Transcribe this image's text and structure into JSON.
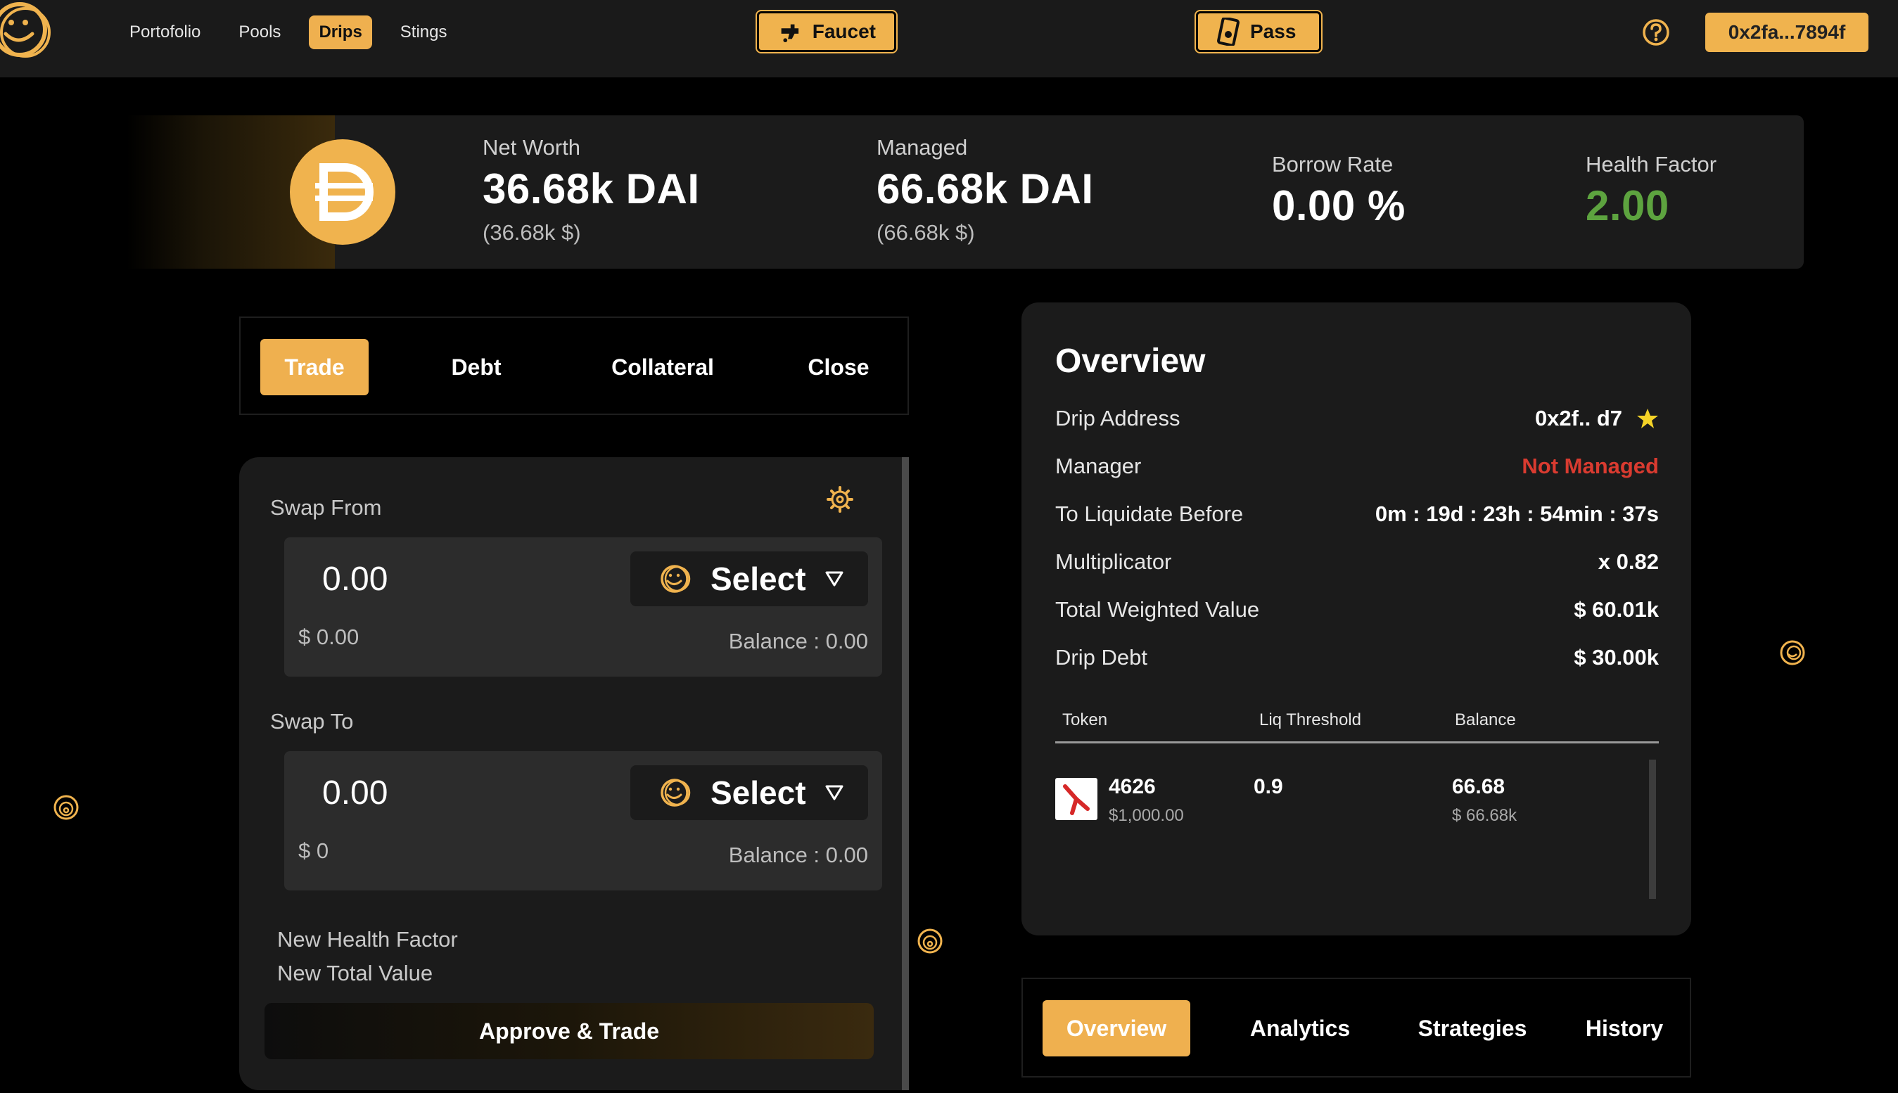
{
  "nav": {
    "items": [
      {
        "label": "Portofolio"
      },
      {
        "label": "Pools"
      },
      {
        "label": "Drips",
        "active": true
      },
      {
        "label": "Stings"
      }
    ]
  },
  "header": {
    "faucet_label": "Faucet",
    "pass_label": "Pass",
    "wallet_address": "0x2fa...7894f",
    "accent_color": "#f0b34e"
  },
  "stats": {
    "net_worth_label": "Net Worth",
    "net_worth_value": "36.68k DAI",
    "net_worth_usd": "(36.68k $)",
    "managed_label": "Managed",
    "managed_value": "66.68k DAI",
    "managed_usd": "(66.68k $)",
    "borrow_label": "Borrow Rate",
    "borrow_value": "0.00 %",
    "health_label": "Health Factor",
    "health_value": "2.00",
    "health_color": "#5da33f"
  },
  "left_tabs": [
    {
      "label": "Trade",
      "active": true
    },
    {
      "label": "Debt"
    },
    {
      "label": "Collateral"
    },
    {
      "label": "Close"
    }
  ],
  "swap": {
    "from_label": "Swap From",
    "from_amount": "0.00",
    "from_usd": "$ 0.00",
    "from_balance": "Balance : 0.00",
    "from_select": "Select",
    "to_label": "Swap To",
    "to_amount": "0.00",
    "to_usd": "$ 0",
    "to_balance": "Balance : 0.00",
    "to_select": "Select",
    "new_health_label": "New Health Factor",
    "new_total_label": "New Total Value",
    "approve_label": "Approve & Trade"
  },
  "overview": {
    "title": "Overview",
    "rows": [
      {
        "key": "Drip Address",
        "value": "0x2f.. d7"
      },
      {
        "key": "Manager",
        "value": "Not Managed"
      },
      {
        "key": "To Liquidate Before",
        "value": "0m : 19d : 23h : 54min : 37s"
      },
      {
        "key": "Multiplicator",
        "value": "x 0.82"
      },
      {
        "key": "Total Weighted Value",
        "value": "$ 60.01k"
      },
      {
        "key": "Drip Debt",
        "value": "$ 30.00k"
      }
    ],
    "table_headers": [
      "Token",
      "Liq Threshold",
      "Balance"
    ],
    "table_rows": [
      {
        "token": "4626",
        "token_sub": "$1,000.00",
        "liq": "0.9",
        "balance": "66.68",
        "balance_sub": "$ 66.68k"
      }
    ]
  },
  "right_tabs": [
    {
      "label": "Overview",
      "active": true
    },
    {
      "label": "Analytics"
    },
    {
      "label": "Strategies"
    },
    {
      "label": "History"
    }
  ],
  "icons": {
    "logo": "smiley-coin-icon",
    "faucet": "faucet-icon",
    "pass": "pass-card-icon",
    "help": "question-circle-icon",
    "dai": "dai-icon",
    "gear": "gear-icon",
    "star": "star-icon",
    "select_caret": "triangle-down-icon"
  }
}
